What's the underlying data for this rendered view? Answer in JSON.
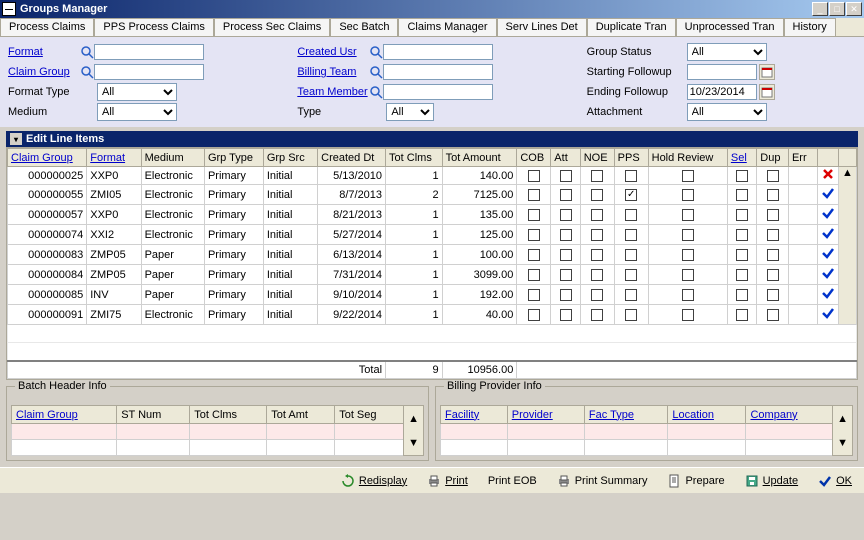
{
  "window": {
    "title": "Groups Manager"
  },
  "menubar": {
    "tabs": [
      "Process Claims",
      "PPS Process Claims",
      "Process Sec Claims",
      "Sec Batch",
      "Claims Manager",
      "Serv Lines Det",
      "Duplicate Tran",
      "Unprocessed Tran",
      "History"
    ]
  },
  "filters": {
    "row1": {
      "format": "Format",
      "createdUsr": "Created Usr",
      "groupStatus": "Group Status",
      "groupStatusVal": "All"
    },
    "row2": {
      "claimGroup": "Claim Group",
      "billingTeam": "Billing Team",
      "startingFollowup": "Starting Followup"
    },
    "row3": {
      "formatType": "Format Type",
      "formatTypeVal": "All",
      "teamMember": "Team Member",
      "endingFollowup": "Ending Followup",
      "endingFollowupVal": "10/23/2014"
    },
    "row4": {
      "medium": "Medium",
      "mediumVal": "All",
      "type": "Type",
      "typeVal": "All",
      "attachment": "Attachment",
      "attachmentVal": "All"
    }
  },
  "grid": {
    "title": "Edit Line Items",
    "headers": [
      "Claim Group",
      "Format",
      "Medium",
      "Grp Type",
      "Grp Src",
      "Created Dt",
      "Tot Clms",
      "Tot Amount",
      "COB",
      "Att",
      "NOE",
      "PPS",
      "Hold Review",
      "Sel",
      "Dup",
      "Err"
    ],
    "rows": [
      {
        "cg": "000000025",
        "fmt": "XXP0",
        "med": "Electronic",
        "gt": "Primary",
        "gs": "Initial",
        "cd": "5/13/2010",
        "tc": "1",
        "ta": "140.00",
        "pps": false,
        "icon": "x"
      },
      {
        "cg": "000000055",
        "fmt": "ZMI05",
        "med": "Electronic",
        "gt": "Primary",
        "gs": "Initial",
        "cd": "8/7/2013",
        "tc": "2",
        "ta": "7125.00",
        "pps": true,
        "icon": "check"
      },
      {
        "cg": "000000057",
        "fmt": "XXP0",
        "med": "Electronic",
        "gt": "Primary",
        "gs": "Initial",
        "cd": "8/21/2013",
        "tc": "1",
        "ta": "135.00",
        "pps": false,
        "icon": "check"
      },
      {
        "cg": "000000074",
        "fmt": "XXI2",
        "med": "Electronic",
        "gt": "Primary",
        "gs": "Initial",
        "cd": "5/27/2014",
        "tc": "1",
        "ta": "125.00",
        "pps": false,
        "icon": "check"
      },
      {
        "cg": "000000083",
        "fmt": "ZMP05",
        "med": "Paper",
        "gt": "Primary",
        "gs": "Initial",
        "cd": "6/13/2014",
        "tc": "1",
        "ta": "100.00",
        "pps": false,
        "icon": "check"
      },
      {
        "cg": "000000084",
        "fmt": "ZMP05",
        "med": "Paper",
        "gt": "Primary",
        "gs": "Initial",
        "cd": "7/31/2014",
        "tc": "1",
        "ta": "3099.00",
        "pps": false,
        "icon": "check"
      },
      {
        "cg": "000000085",
        "fmt": "INV",
        "med": "Paper",
        "gt": "Primary",
        "gs": "Initial",
        "cd": "9/10/2014",
        "tc": "1",
        "ta": "192.00",
        "pps": false,
        "icon": "check"
      },
      {
        "cg": "000000091",
        "fmt": "ZMI75",
        "med": "Electronic",
        "gt": "Primary",
        "gs": "Initial",
        "cd": "9/22/2014",
        "tc": "1",
        "ta": "40.00",
        "pps": false,
        "icon": "check"
      }
    ],
    "total": {
      "label": "Total",
      "tc": "9",
      "ta": "10956.00"
    }
  },
  "batchHeader": {
    "legend": "Batch Header Info",
    "headers": [
      "Claim Group",
      "ST Num",
      "Tot Clms",
      "Tot Amt",
      "Tot Seg"
    ]
  },
  "billingProvider": {
    "legend": "Billing Provider Info",
    "headers": [
      "Facility",
      "Provider",
      "Fac Type",
      "Location",
      "Company"
    ]
  },
  "actions": {
    "redisplay": "Redisplay",
    "print": "Print",
    "printEOB": "Print EOB",
    "printSummary": "Print Summary",
    "prepare": "Prepare",
    "update": "Update",
    "ok": "OK"
  }
}
